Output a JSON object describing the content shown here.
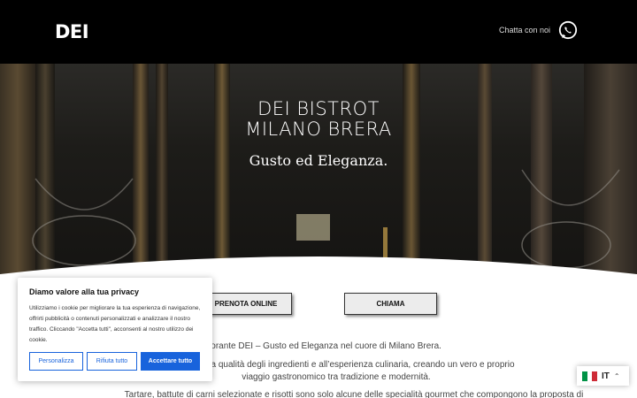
{
  "header": {
    "logo": "DEI",
    "chat_label": "Chatta con noi"
  },
  "hero": {
    "title_line1": "DEI BISTROT",
    "title_line2": "MILANO BRERA",
    "subtitle": "Gusto ed Eleganza."
  },
  "actions": {
    "book_label": "PRENOTA ONLINE",
    "call_label": "CHIAMA"
  },
  "content": {
    "p1": "Ristorante DEI – Gusto ed Eleganza nel cuore di Milano Brera.",
    "p2_line1": "Attenzione alla qualità degli ingredienti e all’esperienza culinaria, creando un vero e proprio",
    "p2_line2": "viaggio gastronomico tra tradizione e modernità.",
    "p3": "Tartare, battute di carni selezionate e risotti sono solo alcune delle specialità gourmet che compongono la proposta di"
  },
  "cookie": {
    "title": "Diamo valore alla tua privacy",
    "text": "Utilizziamo i cookie per migliorare la tua esperienza di navigazione, offrirti pubblicità o contenuti personalizzati e analizzare il nostro traffico. Cliccando \"Accetta tutti\", acconsenti al nostro utilizzo dei cookie.",
    "customize_label": "Personalizza",
    "reject_label": "Rifiuta tutto",
    "accept_label": "Accettare tutto",
    "accent_color": "#1863dc"
  },
  "language": {
    "code": "IT",
    "icon": "italy-flag-icon"
  },
  "icons": {
    "chat": "whatsapp-icon",
    "language_toggle": "chevron-up-icon"
  }
}
